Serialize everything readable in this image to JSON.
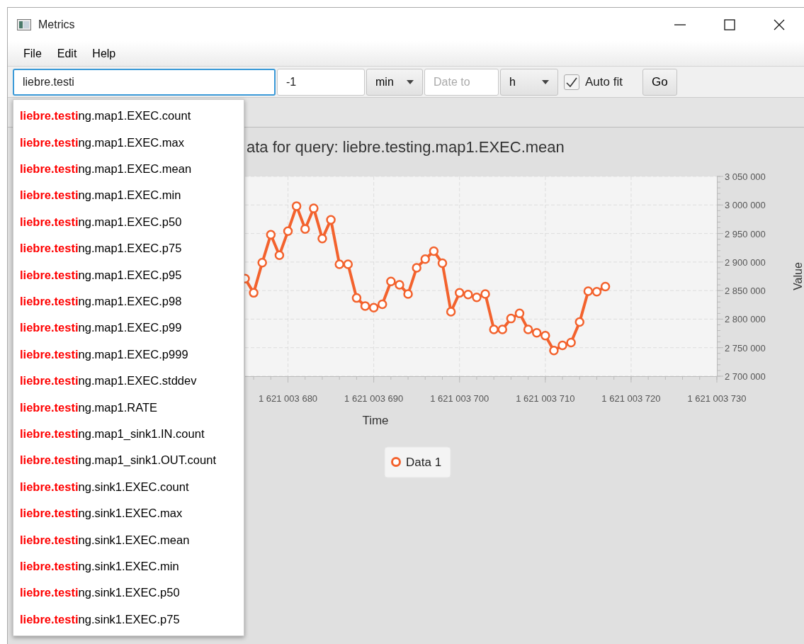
{
  "window": {
    "title": "Metrics"
  },
  "menu": [
    {
      "label": "File"
    },
    {
      "label": "Edit"
    },
    {
      "label": "Help"
    }
  ],
  "toolbar": {
    "query": {
      "value": "liebre.testi",
      "focused": true
    },
    "offset": {
      "value": "-1"
    },
    "unit": {
      "value": "min"
    },
    "date_to": {
      "placeholder": "Date to"
    },
    "step": {
      "value": "h"
    },
    "auto_fit": {
      "label": "Auto fit",
      "checked": true
    },
    "go": "Go"
  },
  "suggestions": [
    {
      "match": "liebre.testi",
      "rest": "ng.map1.EXEC.count"
    },
    {
      "match": "liebre.testi",
      "rest": "ng.map1.EXEC.max"
    },
    {
      "match": "liebre.testi",
      "rest": "ng.map1.EXEC.mean"
    },
    {
      "match": "liebre.testi",
      "rest": "ng.map1.EXEC.min"
    },
    {
      "match": "liebre.testi",
      "rest": "ng.map1.EXEC.p50"
    },
    {
      "match": "liebre.testi",
      "rest": "ng.map1.EXEC.p75"
    },
    {
      "match": "liebre.testi",
      "rest": "ng.map1.EXEC.p95"
    },
    {
      "match": "liebre.testi",
      "rest": "ng.map1.EXEC.p98"
    },
    {
      "match": "liebre.testi",
      "rest": "ng.map1.EXEC.p99"
    },
    {
      "match": "liebre.testi",
      "rest": "ng.map1.EXEC.p999"
    },
    {
      "match": "liebre.testi",
      "rest": "ng.map1.EXEC.stddev"
    },
    {
      "match": "liebre.testi",
      "rest": "ng.map1.RATE"
    },
    {
      "match": "liebre.testi",
      "rest": "ng.map1_sink1.IN.count"
    },
    {
      "match": "liebre.testi",
      "rest": "ng.map1_sink1.OUT.count"
    },
    {
      "match": "liebre.testi",
      "rest": "ng.sink1.EXEC.count"
    },
    {
      "match": "liebre.testi",
      "rest": "ng.sink1.EXEC.max"
    },
    {
      "match": "liebre.testi",
      "rest": "ng.sink1.EXEC.mean"
    },
    {
      "match": "liebre.testi",
      "rest": "ng.sink1.EXEC.min"
    },
    {
      "match": "liebre.testi",
      "rest": "ng.sink1.EXEC.p50"
    },
    {
      "match": "liebre.testi",
      "rest": "ng.sink1.EXEC.p75"
    }
  ],
  "chart": {
    "chart_data": {
      "type": "line",
      "title": "ata for query: liebre.testing.map1.EXEC.mean",
      "xlabel": "Time",
      "ylabel": "Value",
      "x": [
        1621003675,
        1621003676,
        1621003677,
        1621003678,
        1621003679,
        1621003680,
        1621003681,
        1621003682,
        1621003683,
        1621003684,
        1621003685,
        1621003686,
        1621003687,
        1621003688,
        1621003689,
        1621003690,
        1621003691,
        1621003692,
        1621003693,
        1621003694,
        1621003695,
        1621003696,
        1621003697,
        1621003698,
        1621003699,
        1621003700,
        1621003701,
        1621003702,
        1621003703,
        1621003704,
        1621003705,
        1621003706,
        1621003707,
        1621003708,
        1621003709,
        1621003710,
        1621003711,
        1621003712,
        1621003713,
        1621003714,
        1621003715,
        1621003716,
        1621003717
      ],
      "grid": true,
      "series": [
        {
          "name": "Data 1",
          "color": "#f3622d",
          "marker": "circle",
          "values": [
            2871000,
            2846000,
            2899000,
            2948000,
            2912000,
            2954000,
            2998000,
            2958000,
            2994000,
            2941000,
            2974000,
            2896000,
            2896000,
            2837000,
            2823000,
            2820000,
            2826000,
            2866000,
            2860000,
            2844000,
            2890000,
            2905000,
            2919000,
            2898000,
            2813000,
            2846000,
            2843000,
            2838000,
            2844000,
            2782000,
            2782000,
            2801000,
            2810000,
            2782000,
            2776000,
            2771000,
            2745000,
            2754000,
            2759000,
            2795000,
            2849000,
            2848000,
            2857000
          ]
        }
      ],
      "xlim": [
        1621003675,
        1621003730
      ],
      "ylim": [
        2700000,
        3050000
      ],
      "xticks": [
        {
          "value": 1621003680,
          "label": "1 621 003 680"
        },
        {
          "value": 1621003690,
          "label": "1 621 003 690"
        },
        {
          "value": 1621003700,
          "label": "1 621 003 700"
        },
        {
          "value": 1621003710,
          "label": "1 621 003 710"
        },
        {
          "value": 1621003720,
          "label": "1 621 003 720"
        },
        {
          "value": 1621003730,
          "label": "1 621 003 730"
        }
      ],
      "yticks": [
        {
          "value": 2700000,
          "label": "2 700 000"
        },
        {
          "value": 2750000,
          "label": "2 750 000"
        },
        {
          "value": 2800000,
          "label": "2 800 000"
        },
        {
          "value": 2850000,
          "label": "2 850 000"
        },
        {
          "value": 2900000,
          "label": "2 900 000"
        },
        {
          "value": 2950000,
          "label": "2 950 000"
        },
        {
          "value": 3000000,
          "label": "3 000 000"
        },
        {
          "value": 3050000,
          "label": "3 050 000"
        }
      ]
    }
  }
}
